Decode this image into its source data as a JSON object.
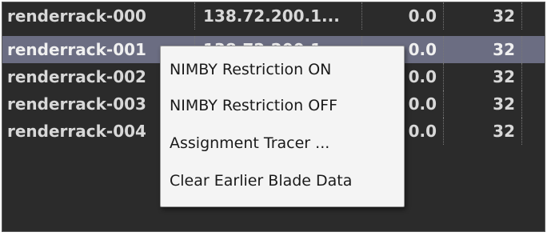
{
  "table": {
    "rows": [
      {
        "name": "renderrack-000",
        "address": "138.72.200.1...",
        "load": "0.0",
        "slots": "32",
        "selected": false
      },
      {
        "name": "renderrack-001",
        "address": "138.72.200.1...",
        "load": "0.0",
        "slots": "32",
        "selected": true
      },
      {
        "name": "renderrack-002",
        "address": "",
        "load": "0.0",
        "slots": "32",
        "selected": false
      },
      {
        "name": "renderrack-003",
        "address": "",
        "load": "0.0",
        "slots": "32",
        "selected": false
      },
      {
        "name": "renderrack-004",
        "address": "",
        "load": "0.0",
        "slots": "32",
        "selected": false
      }
    ]
  },
  "context_menu": {
    "items": [
      {
        "label": "NIMBY Restriction ON"
      },
      {
        "label": "NIMBY Restriction OFF"
      },
      {
        "label": "Assignment Tracer ..."
      },
      {
        "label": "Clear Earlier Blade Data"
      }
    ]
  },
  "colors": {
    "table_background": "#2b2b2b",
    "selected_row": "#6b6d82",
    "row_text": "#d8d8d8",
    "menu_background": "#f4f4f4",
    "menu_text": "#1a1a1a"
  }
}
